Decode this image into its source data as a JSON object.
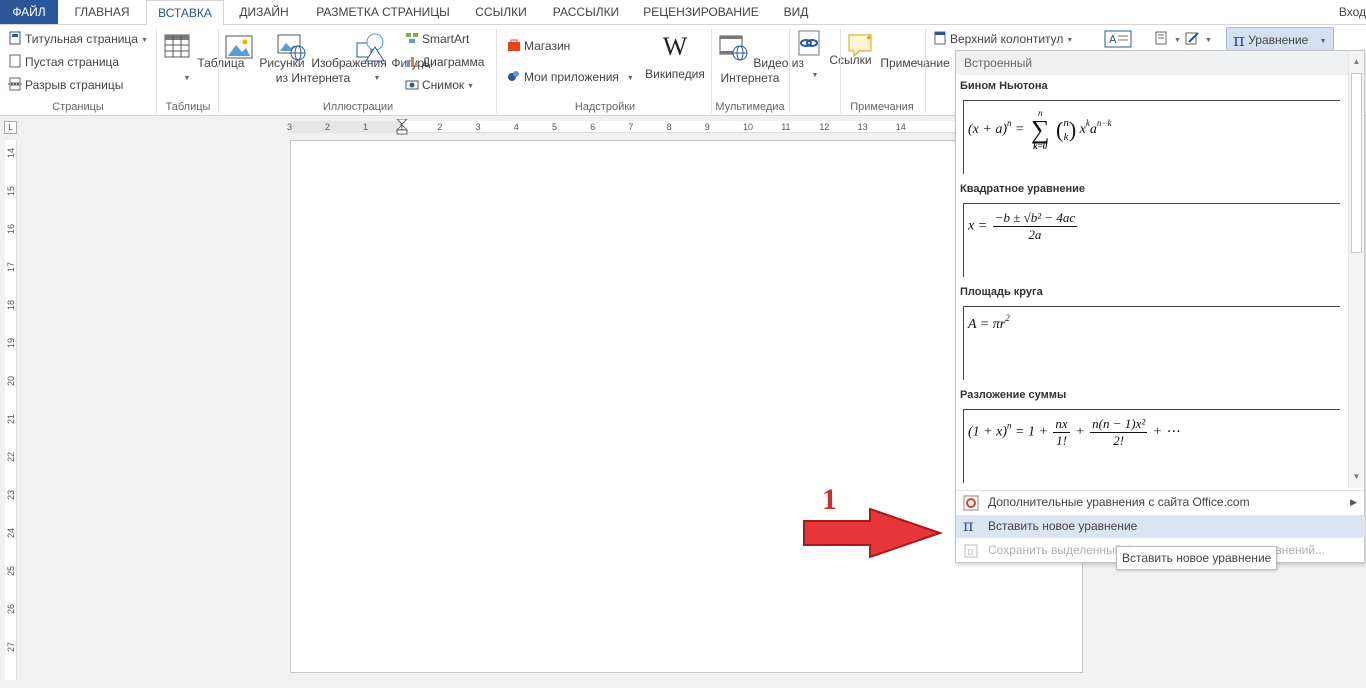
{
  "tabs": [
    "ФАЙЛ",
    "ГЛАВНАЯ",
    "ВСТАВКА",
    "ДИЗАЙН",
    "РАЗМЕТКА СТРАНИЦЫ",
    "ССЫЛКИ",
    "РАССЫЛКИ",
    "РЕЦЕНЗИРОВАНИЕ",
    "ВИД"
  ],
  "active_tab": "ВСТАВКА",
  "signin": "Вход",
  "ribbon": {
    "pages": {
      "cover": "Титульная страница",
      "blank": "Пустая страница",
      "break": "Разрыв страницы",
      "label": "Страницы"
    },
    "tables": {
      "table": "Таблица",
      "label": "Таблицы"
    },
    "illustrations": {
      "pictures": "Рисунки",
      "online_line1": "Изображения",
      "online_line2": "из Интернета",
      "shapes": "Фигуры",
      "smartart": "SmartArt",
      "chart": "Диаграмма",
      "screenshot": "Снимок",
      "label": "Иллюстрации"
    },
    "addins": {
      "store": "Магазин",
      "my_apps": "Мои приложения",
      "wikipedia": "Википедия",
      "wiki_logo": "W",
      "label": "Надстройки"
    },
    "media": {
      "video_line1": "Видео из",
      "video_line2": "Интернета",
      "label": "Мультимедиа"
    },
    "links": {
      "links": "Ссылки"
    },
    "comments": {
      "comment": "Примечание",
      "label": "Примечания"
    },
    "header": {
      "header": "Верхний колонтитул"
    },
    "equation_button": "Уравнение",
    "pi_symbol": "π"
  },
  "ruler": {
    "horizontal": [
      "3",
      "2",
      "1",
      "1",
      "2",
      "3",
      "4",
      "5",
      "6",
      "7",
      "8",
      "9",
      "10",
      "11",
      "12",
      "13",
      "14"
    ],
    "vertical": [
      "14",
      "15",
      "16",
      "17",
      "18",
      "19",
      "20",
      "21",
      "22",
      "23",
      "24",
      "25",
      "26",
      "27"
    ],
    "corner": "L"
  },
  "dropdown": {
    "section": "Встроенный",
    "equations": [
      {
        "title": "Бином Ньютона"
      },
      {
        "title": "Квадратное уравнение"
      },
      {
        "title": "Площадь круга"
      },
      {
        "title": "Разложение суммы"
      }
    ],
    "binomial": {
      "lhs": "(x + a)",
      "n": "n",
      "eq": " =",
      "sum_top": "n",
      "sum_bottom": "k=0",
      "bn": "n",
      "bk": "k",
      "x": "x",
      "k": "k",
      "a": "a",
      "nk": "n−k"
    },
    "quadratic": {
      "lhs": "x =",
      "num": "−b ± √b² − 4ac",
      "den": "2a"
    },
    "circle": {
      "lhs": "A = πr",
      "exp": "2"
    },
    "expansion": {
      "lhs": "(1 + x)",
      "n": "n",
      "eq": " = 1 +",
      "f1num": "nx",
      "f1den": "1!",
      "plus": "+",
      "f2num": "n(n − 1)x²",
      "f2den": "2!",
      "tail": "+ ⋯"
    },
    "items": {
      "more": "Дополнительные уравнения с сайта Office.com",
      "insert": "Вставить новое уравнение",
      "save": "Сохранить выделенный фрагмент в коллекцию уравнений..."
    }
  },
  "tooltip": "Вставить новое уравнение",
  "annotation": {
    "number": "1"
  },
  "colors": {
    "accent": "#2b579a",
    "arrow": "#e8353a",
    "highlight": "#dbe4f1"
  }
}
